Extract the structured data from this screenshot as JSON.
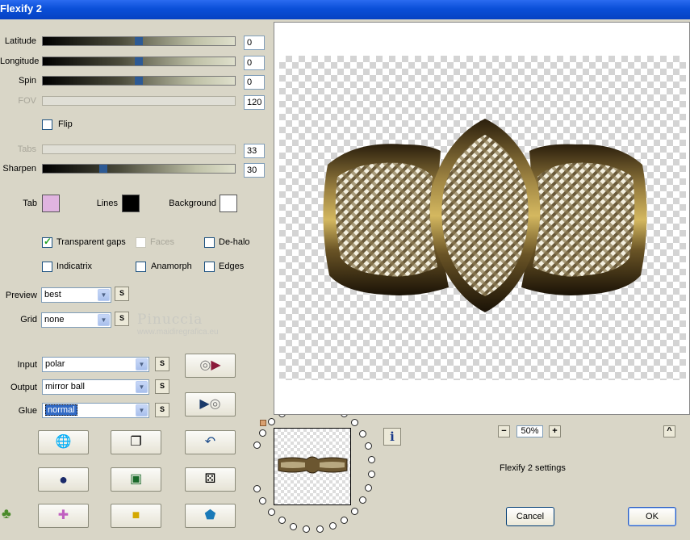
{
  "window": {
    "title": "Flexify 2"
  },
  "sliders": [
    {
      "label": "Latitude",
      "value": "0",
      "level": 0.5,
      "enabled": true
    },
    {
      "label": "Longitude",
      "value": "0",
      "level": 0.5,
      "enabled": true
    },
    {
      "label": "Spin",
      "value": "0",
      "level": 0.5,
      "enabled": true
    },
    {
      "label": "FOV",
      "value": "120",
      "level": 0.5,
      "enabled": false
    },
    {
      "label": "Tabs",
      "value": "33",
      "level": 0.5,
      "enabled": false
    },
    {
      "label": "Sharpen",
      "value": "30",
      "level": 0.3,
      "enabled": true
    }
  ],
  "flip": {
    "label": "Flip",
    "checked": false
  },
  "colors": {
    "tab": {
      "label": "Tab",
      "value": "#e0b4e0"
    },
    "lines": {
      "label": "Lines",
      "value": "#000000"
    },
    "background": {
      "label": "Background",
      "value": "#ffffff"
    }
  },
  "checkboxes": [
    {
      "label": "Transparent gaps",
      "checked": true,
      "enabled": true
    },
    {
      "label": "Faces",
      "checked": false,
      "enabled": false
    },
    {
      "label": "De-halo",
      "checked": false,
      "enabled": true
    },
    {
      "label": "Indicatrix",
      "checked": false,
      "enabled": true
    },
    {
      "label": "Anamorph",
      "checked": false,
      "enabled": true
    },
    {
      "label": "Edges",
      "checked": false,
      "enabled": true
    }
  ],
  "preview_select": {
    "label": "Preview",
    "value": "best"
  },
  "grid_select": {
    "label": "Grid",
    "value": "none"
  },
  "input_select": {
    "label": "Input",
    "value": "polar"
  },
  "output_select": {
    "label": "Output",
    "value": "mirror ball"
  },
  "glue_select": {
    "label": "Glue",
    "value": "normal"
  },
  "s_label": "S",
  "watermark": {
    "name": "Pinuccia",
    "site": "www.maidiregrafica.eu"
  },
  "zoom": {
    "value": "50%",
    "minus": "−",
    "plus": "+"
  },
  "info_label": "i",
  "up_label": "^",
  "settings_label": "Flexify 2 settings",
  "cancel_label": "Cancel",
  "ok_label": "OK",
  "accent": "#0a4fd8"
}
